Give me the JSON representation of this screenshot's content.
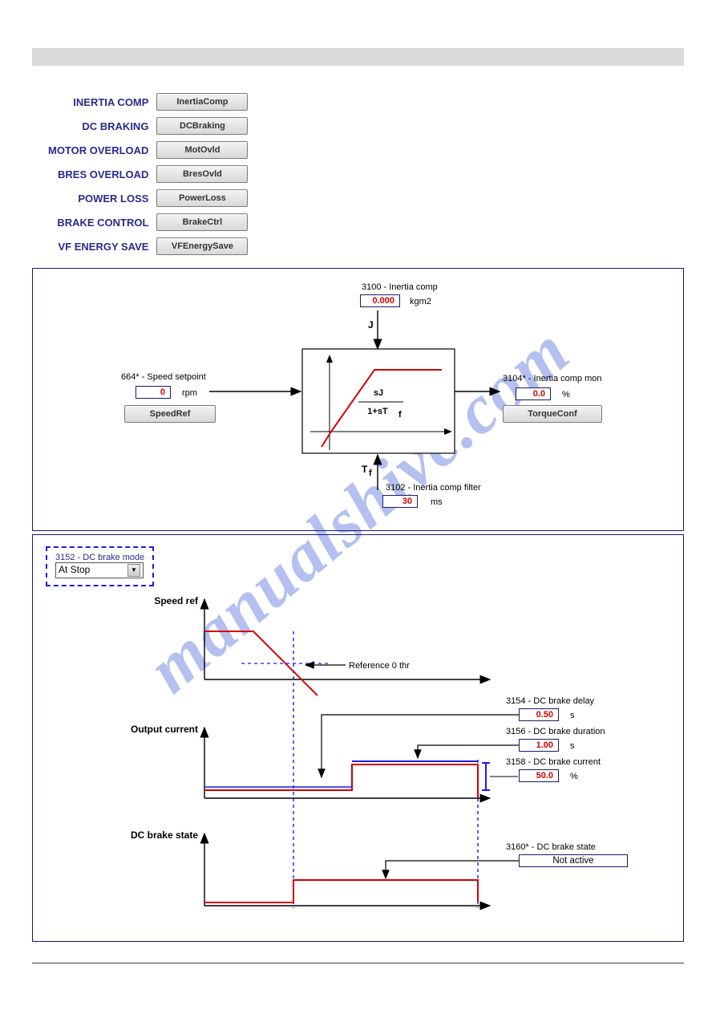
{
  "watermark": "manualshive.com",
  "menu": [
    {
      "label": "INERTIA COMP",
      "button": "InertiaComp"
    },
    {
      "label": "DC BRAKING",
      "button": "DCBraking"
    },
    {
      "label": "MOTOR OVERLOAD",
      "button": "MotOvld"
    },
    {
      "label": "BRES OVERLOAD",
      "button": "BresOvld"
    },
    {
      "label": "POWER LOSS",
      "button": "PowerLoss"
    },
    {
      "label": "BRAKE CONTROL",
      "button": "BrakeCtrl"
    },
    {
      "label": "VF ENERGY SAVE",
      "button": "VFEnergySave"
    }
  ],
  "inertia_panel": {
    "p3100": {
      "label": "3100 - Inertia comp",
      "value": "0.000",
      "unit": "kgm2"
    },
    "j_symbol": "J",
    "tf_symbol": "Tf",
    "p664": {
      "label": "664* - Speed setpoint",
      "value": "0",
      "unit": "rpm",
      "button": "SpeedRef"
    },
    "p3104": {
      "label": "3104* - Inertia comp mon",
      "value": "0.0",
      "unit": "%",
      "button": "TorqueConf"
    },
    "p3102": {
      "label": "3102 - Inertia comp filter",
      "value": "30",
      "unit": "ms"
    },
    "tf_equation_num": "sJ",
    "tf_equation_den": "1+sT",
    "tf_equation_sub": "f"
  },
  "dcbrake_panel": {
    "p3152": {
      "label": "3152 - DC brake mode",
      "value": "At Stop"
    },
    "axis1": "Speed ref",
    "ref0": "Reference 0 thr",
    "axis2": "Output current",
    "axis3": "DC brake state",
    "p3154": {
      "label": "3154 - DC brake delay",
      "value": "0.50",
      "unit": "s"
    },
    "p3156": {
      "label": "3156 - DC brake duration",
      "value": "1.00",
      "unit": "s"
    },
    "p3158": {
      "label": "3158 - DC brake current",
      "value": "50.0",
      "unit": "%"
    },
    "p3160": {
      "label": "3160* - DC brake state",
      "value": "Not active"
    }
  },
  "chart_data": [
    {
      "type": "line",
      "title": "Inertia compensation transfer function block",
      "annotations": [
        "sJ / (1 + sT_f)"
      ],
      "inputs": [
        "Speed setpoint (rpm)",
        "Inertia comp J (kgm2)",
        "Inertia comp filter Tf (ms)"
      ],
      "outputs": [
        "Inertia comp mon (%)"
      ]
    },
    {
      "type": "line",
      "title": "DC braking timing diagram",
      "series": [
        {
          "name": "Speed ref",
          "shape": "ramp down then zero",
          "threshold": "Reference 0 thr"
        },
        {
          "name": "Output current",
          "shape": "baseline then step to DC brake current after delay for duration"
        },
        {
          "name": "DC brake state",
          "shape": "low then high pulse during braking"
        }
      ],
      "parameters": {
        "DC brake delay (s)": 0.5,
        "DC brake duration (s)": 1.0,
        "DC brake current (%)": 50.0
      }
    }
  ]
}
